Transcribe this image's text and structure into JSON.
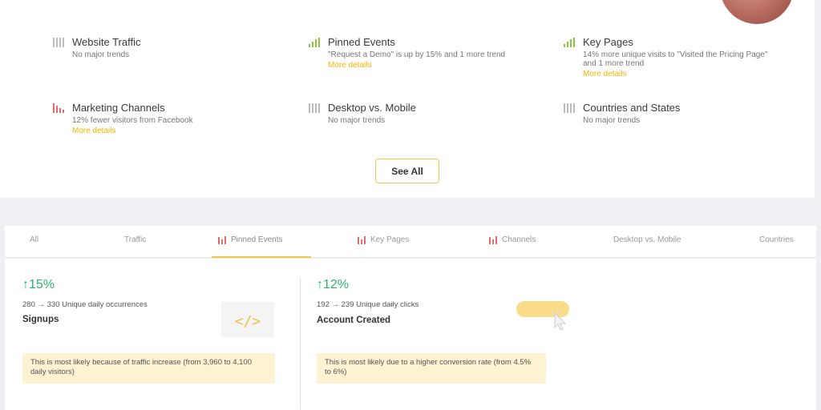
{
  "insights": [
    {
      "title": "Website Traffic",
      "desc": "No major trends",
      "more": "",
      "icon": "bars-gray-icon"
    },
    {
      "title": "Pinned Events",
      "desc": "\"Request a Demo\" is up by 15% and 1 more trend",
      "more": "More details",
      "icon": "bars-green-icon"
    },
    {
      "title": "Key Pages",
      "desc": "14% more unique visits to \"Visited the Pricing Page\" and 1 more trend",
      "more": "More details",
      "icon": "bars-green-icon"
    },
    {
      "title": "Marketing Channels",
      "desc": "12% fewer visitors from Facebook",
      "more": "More details",
      "icon": "bars-red-icon"
    },
    {
      "title": "Desktop vs. Mobile",
      "desc": "No major trends",
      "more": "",
      "icon": "bars-gray-icon"
    },
    {
      "title": "Countries and States",
      "desc": "No major trends",
      "more": "",
      "icon": "bars-gray-icon"
    }
  ],
  "see_all_label": "See All",
  "tabs": [
    "All",
    "Traffic",
    "Pinned Events",
    "Key Pages",
    "Channels",
    "Desktop vs. Mobile",
    "Countries"
  ],
  "active_tab": "Pinned Events",
  "cards": [
    {
      "change": "↑15%",
      "detail": "280 → 330 Unique daily occurrences",
      "metric": "Signups",
      "note": "This is most likely because of traffic increase (from 3,960 to 4,100 daily visitors)"
    },
    {
      "change": "↑12%",
      "detail": "192 → 239 Unique daily clicks",
      "metric": "Account Created",
      "note": "This is most likely due to a higher conversion rate (from 4.5% to 6%)"
    }
  ],
  "code_glyph": "</>",
  "colors": {
    "accent": "#f3c64a",
    "positive": "#30b36b",
    "negative": "#e36b6b",
    "link": "#f5b400"
  }
}
